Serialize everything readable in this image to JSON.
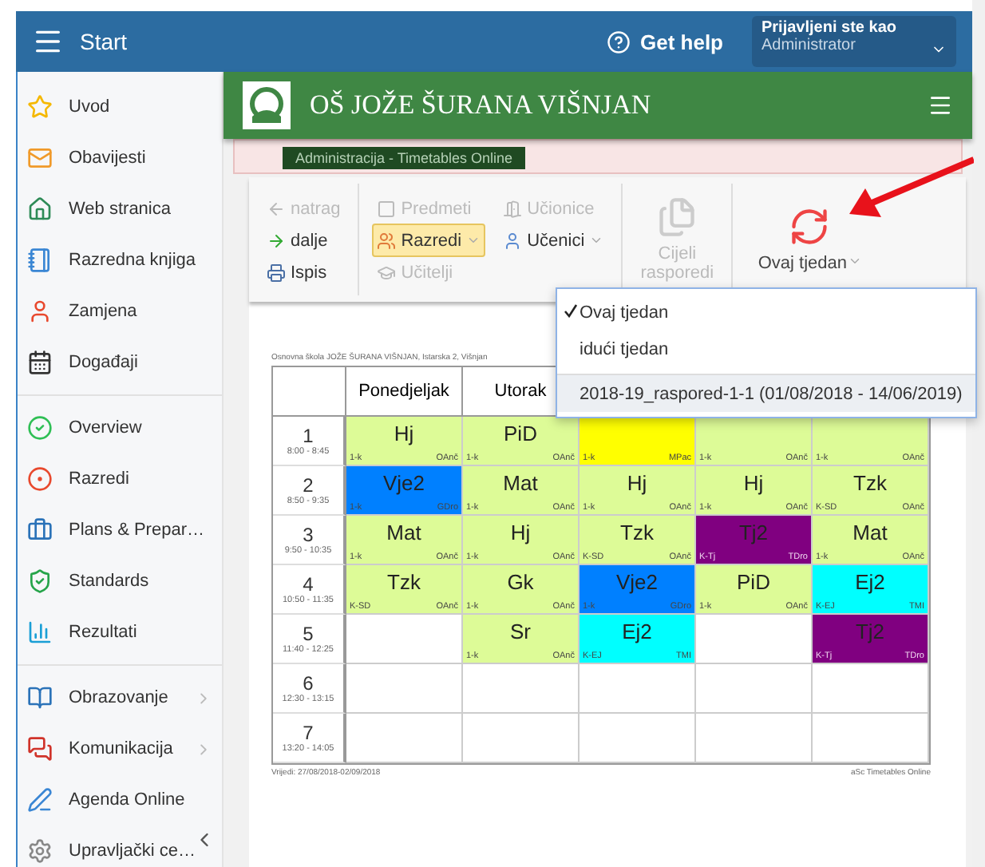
{
  "topbar": {
    "menu_label": "Start",
    "help_label": "Get help",
    "user_caption": "Prijavljeni ste kao",
    "user_role": "Administrator"
  },
  "sidebar": {
    "groups": [
      [
        {
          "label": "Uvod",
          "has_submenu": false
        },
        {
          "label": "Obavijesti",
          "has_submenu": false
        },
        {
          "label": "Web stranica",
          "has_submenu": false
        },
        {
          "label": "Razredna knjiga",
          "has_submenu": false
        },
        {
          "label": "Zamjena",
          "has_submenu": false
        },
        {
          "label": "Događaji",
          "has_submenu": false
        }
      ],
      [
        {
          "label": "Overview",
          "has_submenu": false
        },
        {
          "label": "Razredi",
          "has_submenu": false
        },
        {
          "label": "Plans & Prepar…",
          "has_submenu": false
        },
        {
          "label": "Standards",
          "has_submenu": false
        },
        {
          "label": "Rezultati",
          "has_submenu": false
        }
      ],
      [
        {
          "label": "Obrazovanje",
          "has_submenu": true
        },
        {
          "label": "Komunikacija",
          "has_submenu": true
        },
        {
          "label": "Agenda Online",
          "has_submenu": false
        },
        {
          "label": "Upravljački ce…",
          "has_submenu": false
        }
      ]
    ]
  },
  "school": {
    "name": "OŠ JOŽE ŠURANA VIŠNJAN",
    "banner": "Administracija - Timetables Online"
  },
  "toolbar": {
    "groups": [
      [
        {
          "label": "natrag",
          "disabled": true,
          "selected": false,
          "dropdown": false
        },
        {
          "label": "dalje",
          "disabled": false,
          "selected": false,
          "dropdown": false
        },
        {
          "label": "Ispis",
          "disabled": false,
          "selected": false,
          "dropdown": false
        }
      ],
      [
        {
          "label": "Predmeti",
          "disabled": true,
          "selected": false,
          "dropdown": false
        },
        {
          "label": "Razredi",
          "disabled": false,
          "selected": true,
          "dropdown": true
        },
        {
          "label": "Učitelji",
          "disabled": true,
          "selected": false,
          "dropdown": false
        },
        {
          "label": "Učionice",
          "disabled": true,
          "selected": false,
          "dropdown": false
        },
        {
          "label": "Učenici",
          "disabled": false,
          "selected": false,
          "dropdown": true
        }
      ],
      [
        {
          "label": "Cijeli rasporedi",
          "disabled": true,
          "selected": false,
          "dropdown": false
        }
      ],
      [
        {
          "label": "Ovaj tjedan",
          "disabled": false,
          "selected": false,
          "dropdown": true
        }
      ]
    ]
  },
  "week_menu": [
    {
      "label": "Ovaj tjedan",
      "checked": true,
      "selected": false
    },
    {
      "label": "idući tjedan",
      "checked": false,
      "selected": false
    },
    {
      "label": "2018-19_raspored-1-1 (01/08/2018 - 14/06/2019)",
      "checked": false,
      "selected": true
    }
  ],
  "timetable": {
    "caption": "Osnovna škola JOŽE ŠURANA VIŠNJAN, Istarska 2, Višnjan",
    "days": [
      "Ponedjeljak",
      "Utorak"
    ],
    "periods": [
      {
        "number": "1",
        "time": "8:00 - 8:45",
        "lessons": [
          {
            "subject": "Hj",
            "group": "1-k",
            "teacher": "OAnč",
            "color": "#ddfb97"
          },
          {
            "subject": "PiD",
            "group": "1-k",
            "teacher": "OAnč",
            "color": "#ddfb97"
          },
          {
            "group": "1-k",
            "teacher": "MPac",
            "color": "#ffff00"
          },
          {
            "group": "1-k",
            "teacher": "OAnč",
            "color": "#ddfb97"
          },
          {
            "group": "1-k",
            "teacher": "OAnč",
            "color": "#ddfb97"
          }
        ]
      },
      {
        "number": "2",
        "time": "8:50 - 9:35",
        "lessons": [
          {
            "subject": "Vje2",
            "group": "1-k",
            "teacher": "GDro",
            "color": "#0080ff"
          },
          {
            "subject": "Mat",
            "group": "1-k",
            "teacher": "OAnč",
            "color": "#ddfb97"
          },
          {
            "subject": "Hj",
            "group": "1-k",
            "teacher": "OAnč",
            "color": "#ddfb97"
          },
          {
            "subject": "Hj",
            "group": "1-k",
            "teacher": "OAnč",
            "color": "#ddfb97"
          },
          {
            "subject": "Tzk",
            "group": "K-SD",
            "teacher": "OAnč",
            "color": "#ddfb97"
          }
        ]
      },
      {
        "number": "3",
        "time": "9:50 - 10:35",
        "lessons": [
          {
            "subject": "Mat",
            "group": "1-k",
            "teacher": "OAnč",
            "color": "#ddfb97"
          },
          {
            "subject": "Hj",
            "group": "1-k",
            "teacher": "OAnč",
            "color": "#ddfb97"
          },
          {
            "subject": "Tzk",
            "group": "K-SD",
            "teacher": "OAnč",
            "color": "#ddfb97"
          },
          {
            "subject": "Tj2",
            "group": "K-Tj",
            "teacher": "TDro",
            "color": "#800080"
          },
          {
            "subject": "Mat",
            "group": "1-k",
            "teacher": "OAnč",
            "color": "#ddfb97"
          }
        ]
      },
      {
        "number": "4",
        "time": "10:50 - 11:35",
        "lessons": [
          {
            "subject": "Tzk",
            "group": "K-SD",
            "teacher": "OAnč",
            "color": "#ddfb97"
          },
          {
            "subject": "Gk",
            "group": "1-k",
            "teacher": "OAnč",
            "color": "#ddfb97"
          },
          {
            "subject": "Vje2",
            "group": "1-k",
            "teacher": "GDro",
            "color": "#0080ff"
          },
          {
            "subject": "PiD",
            "group": "1-k",
            "teacher": "OAnč",
            "color": "#ddfb97"
          },
          {
            "subject": "Ej2",
            "group": "K-EJ",
            "teacher": "TMI",
            "color": "#00ffff"
          }
        ]
      },
      {
        "number": "5",
        "time": "11:40 - 12:25",
        "lessons": [
          {
            "kind": "empty"
          },
          {
            "subject": "Sr",
            "group": "1-k",
            "teacher": "OAnč",
            "color": "#ddfb97"
          },
          {
            "subject": "Ej2",
            "group": "K-EJ",
            "teacher": "TMI",
            "color": "#00ffff"
          },
          {
            "kind": "empty"
          },
          {
            "subject": "Tj2",
            "group": "K-Tj",
            "teacher": "TDro",
            "color": "#800080"
          }
        ]
      },
      {
        "number": "6",
        "time": "12:30 - 13:15",
        "lessons": [
          {
            "kind": "empty"
          },
          {
            "kind": "empty"
          },
          {
            "kind": "empty"
          },
          {
            "kind": "empty"
          },
          {
            "kind": "empty"
          }
        ]
      },
      {
        "number": "7",
        "time": "13:20 - 14:05",
        "lessons": [
          {
            "kind": "empty"
          },
          {
            "kind": "empty"
          },
          {
            "kind": "empty"
          },
          {
            "kind": "empty"
          },
          {
            "kind": "empty"
          }
        ]
      }
    ],
    "validity": "Vrijedi: 27/08/2018-02/09/2018",
    "credit": "aSc Timetables Online"
  }
}
